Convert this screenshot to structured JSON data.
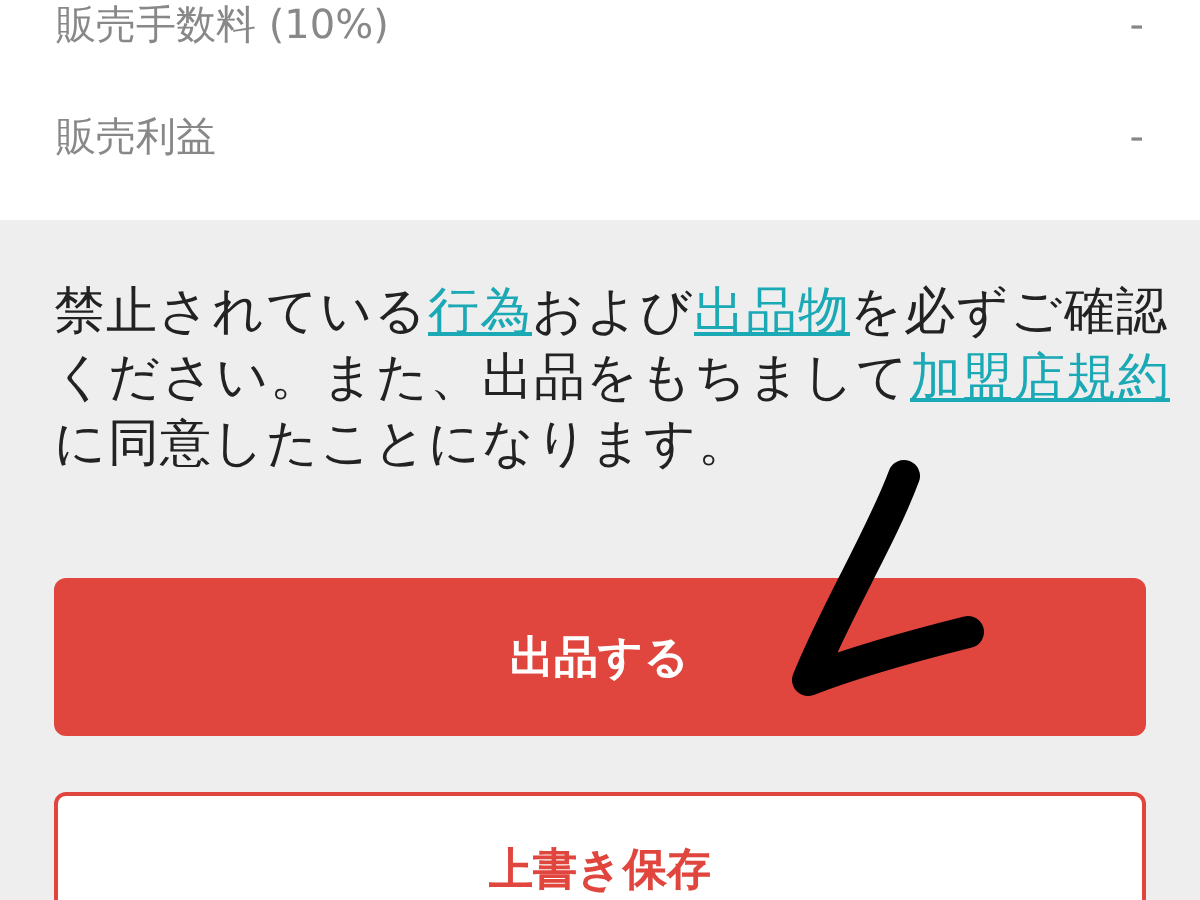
{
  "summary_rows": [
    {
      "label": "販売手数料 (10%)",
      "value": "-"
    },
    {
      "label": "販売利益",
      "value": "-"
    }
  ],
  "notice": [
    {
      "kind": "text",
      "text": "禁止されている"
    },
    {
      "kind": "link",
      "text": "行為"
    },
    {
      "kind": "text",
      "text": "および"
    },
    {
      "kind": "link",
      "text": "出品物"
    },
    {
      "kind": "text",
      "text": "を必ずご確認ください。また、出品をもちまして"
    },
    {
      "kind": "link",
      "text": "加盟店規約"
    },
    {
      "kind": "text",
      "text": "に同意したことになります。"
    }
  ],
  "buttons": [
    {
      "kind": "primary",
      "label": "出品する"
    },
    {
      "kind": "outline",
      "label": "上書き保存"
    }
  ]
}
